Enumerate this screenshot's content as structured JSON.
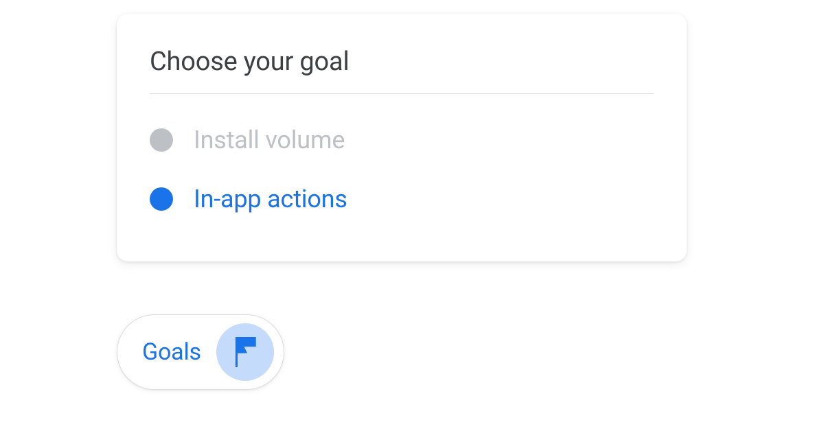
{
  "card": {
    "title": "Choose your goal",
    "options": [
      {
        "label": "Install volume",
        "selected": false
      },
      {
        "label": "In-app actions",
        "selected": true
      }
    ]
  },
  "pill": {
    "label": "Goals",
    "icon": "flag-icon"
  },
  "colors": {
    "accent": "#1a73e8",
    "accentLight": "#c5dbfc",
    "muted": "#bdc1c6",
    "text": "#3c4043",
    "divider": "#dadce0"
  }
}
